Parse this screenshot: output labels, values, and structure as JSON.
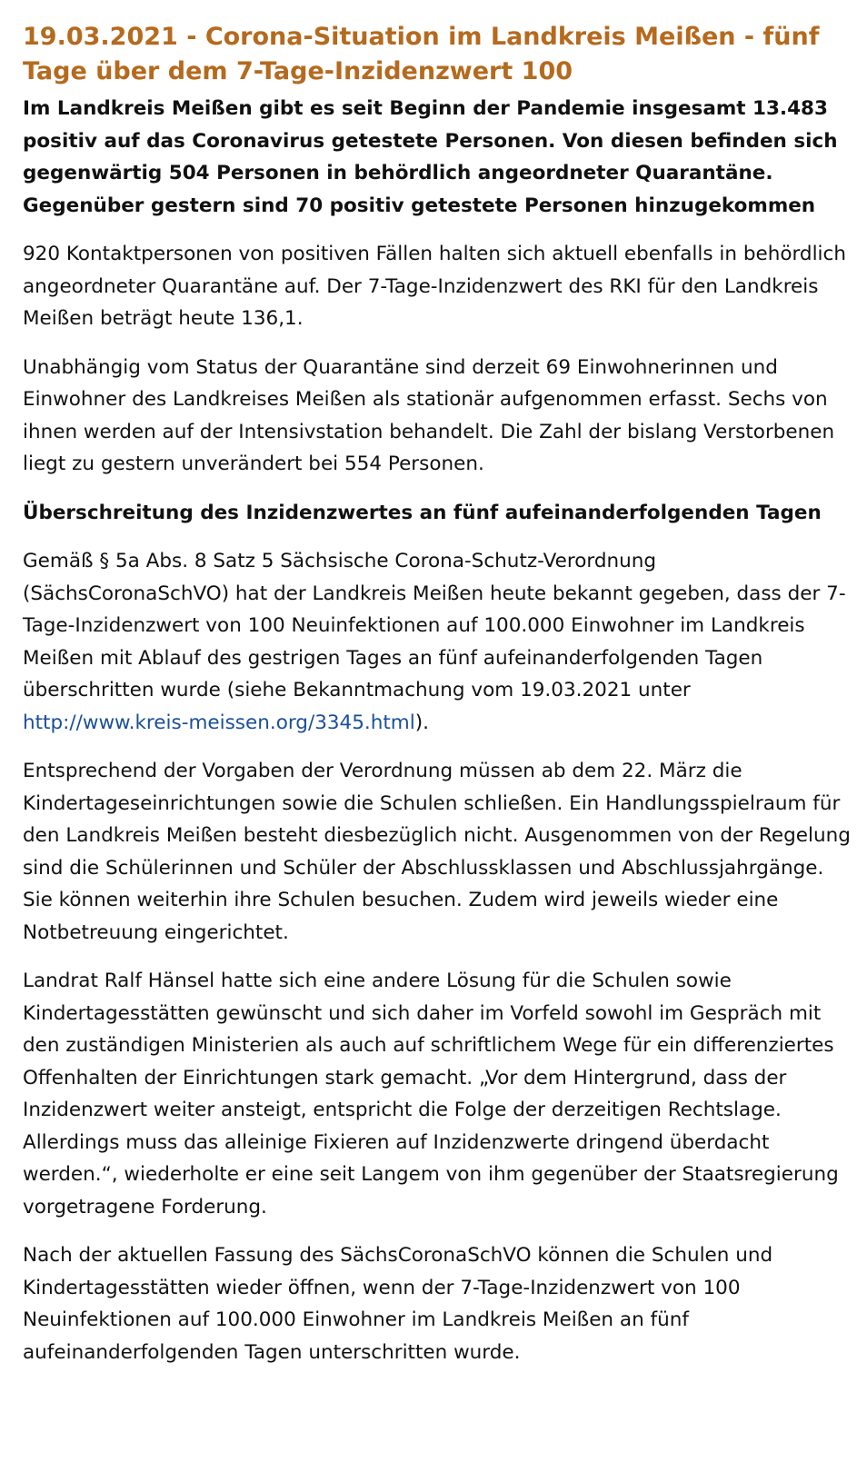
{
  "article": {
    "headline": "19.03.2021 - Corona-Situation im Landkreis Meißen - fünf Tage über dem 7-Tage-Inzidenzwert 100",
    "lead": "Im Landkreis Meißen gibt es seit Beginn der Pandemie insgesamt 13.483 positiv auf das Coronavirus getestete Personen. Von diesen befinden sich gegenwärtig 504 Personen in behördlich angeordneter Quarantäne. Gegenüber gestern sind 70 positiv getestete Personen hinzugekommen",
    "paragraph_1": "920 Kontaktpersonen von positiven Fällen halten sich aktuell ebenfalls in behördlich angeordneter Quarantäne auf. Der 7-Tage-Inzidenzwert des RKI für den Landkreis Meißen beträgt heute 136,1.",
    "paragraph_2": "Unabhängig vom Status der Quarantäne sind derzeit 69 Einwohnerinnen und Einwohner des Landkreises Meißen als stationär aufgenommen erfasst. Sechs von ihnen werden auf der Intensivstation behandelt. Die Zahl der bislang Verstorbenen liegt zu gestern unverändert bei 554 Personen.",
    "subheading": "Überschreitung des Inzidenzwertes an fünf aufeinanderfolgenden Tagen",
    "paragraph_3": {
      "before_link": "Gemäß § 5a Abs. 8 Satz 5 Sächsische Corona-Schutz-Verordnung (SächsCoronaSchVO) hat der Landkreis Meißen heute bekannt gegeben, dass der 7-Tage-Inzidenzwert von 100 Neuinfektionen auf 100.000 Einwohner im Landkreis Meißen mit Ablauf des gestrigen Tages an fünf aufeinanderfolgenden Tagen überschritten wurde (siehe Bekanntmachung vom 19.03.2021 unter ",
      "link_text": "http://www.kreis-meissen.org/3345.html",
      "after_link": ")."
    },
    "paragraph_4": "Entsprechend der Vorgaben der Verordnung müssen ab dem 22. März die Kindertageseinrichtungen sowie die Schulen schließen. Ein Handlungsspielraum für den Landkreis Meißen besteht diesbezüglich nicht. Ausgenommen von der Regelung sind die Schülerinnen und Schüler der Abschlussklassen und Abschlussjahrgänge. Sie können weiterhin ihre Schulen besuchen. Zudem wird jeweils wieder eine Notbetreuung eingerichtet.",
    "paragraph_5": "Landrat Ralf Hänsel hatte sich eine andere Lösung für die Schulen sowie Kindertagesstätten gewünscht und sich daher im Vorfeld sowohl im Gespräch mit den zuständigen Ministerien als auch auf schriftlichem Wege für ein differenziertes Offenhalten der Einrichtungen stark gemacht. „Vor dem Hintergrund, dass der Inzidenzwert weiter ansteigt, entspricht die Folge der derzeitigen Rechtslage. Allerdings muss das alleinige Fixieren auf Inzidenzwerte dringend überdacht werden.“, wiederholte er eine seit Langem von ihm gegenüber der Staatsregierung vorgetragene Forderung.",
    "paragraph_6": "Nach der aktuellen Fassung des SächsCoronaSchVO können die Schulen und Kindertagesstätten wieder öffnen, wenn der 7-Tage-Inzidenzwert von 100 Neuinfektionen auf 100.000 Einwohner im Landkreis Meißen an fünf aufeinanderfolgenden Tagen unterschritten wurde."
  },
  "colors": {
    "headline": "#b56a1e",
    "text": "#111111",
    "link": "#1a4f9a"
  }
}
